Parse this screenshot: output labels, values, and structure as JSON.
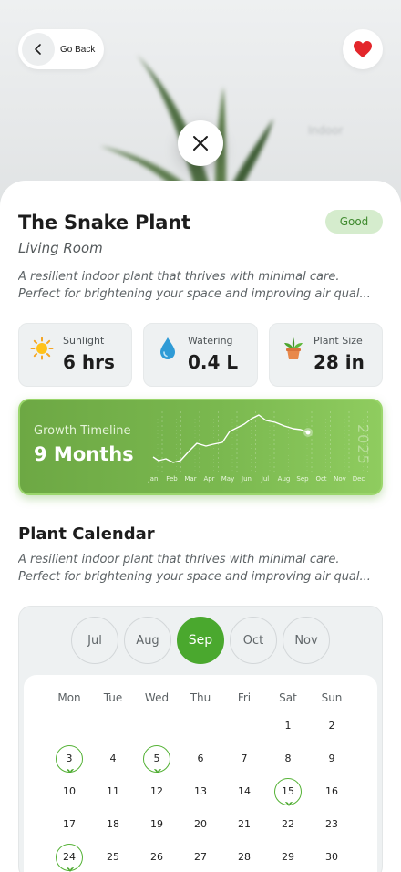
{
  "header": {
    "back_label": "Go Back",
    "hero_tag": "Indoor"
  },
  "plant": {
    "name": "The Snake Plant",
    "location": "Living Room",
    "status": "Good",
    "description": "A resilient indoor plant that thrives with minimal care. Perfect for brightening your space and improving air qual...",
    "description_line1": "A resilient indoor plant that thrives with minimal care.",
    "description_line2": "Perfect for brightening your space and improving air qual..."
  },
  "stats": [
    {
      "icon": "sun-icon",
      "label": "Sunlight",
      "value": "6 hrs"
    },
    {
      "icon": "water-drop-icon",
      "label": "Watering",
      "value": "0.4 L"
    },
    {
      "icon": "potted-plant-icon",
      "label": "Plant Size",
      "value": "28 in"
    }
  ],
  "growth": {
    "label": "Growth Timeline",
    "value": "9 Months",
    "year": "2025",
    "months": [
      "Jan",
      "Feb",
      "Mar",
      "Apr",
      "May",
      "Jun",
      "Jul",
      "Aug",
      "Sep",
      "Oct",
      "Nov",
      "Dec"
    ]
  },
  "calendar": {
    "title": "Plant Calendar",
    "description_line1": "A resilient indoor plant that thrives with minimal care.",
    "description_line2": "Perfect for brightening your space and improving air qual...",
    "months": [
      "Jul",
      "Aug",
      "Sep",
      "Oct",
      "Nov"
    ],
    "selected_month": "Sep",
    "weekdays": [
      "Mon",
      "Tue",
      "Wed",
      "Thu",
      "Fri",
      "Sat",
      "Sun"
    ],
    "weeks": [
      [
        "",
        "",
        "",
        "",
        "",
        "1",
        "2"
      ],
      [
        "3",
        "4",
        "5",
        "6",
        "7",
        "8",
        "9"
      ],
      [
        "10",
        "11",
        "12",
        "13",
        "14",
        "15",
        "16"
      ],
      [
        "17",
        "18",
        "19",
        "20",
        "21",
        "22",
        "23"
      ],
      [
        "24",
        "25",
        "26",
        "27",
        "28",
        "29",
        "30"
      ]
    ],
    "watering_days": [
      "3",
      "5",
      "15",
      "24"
    ]
  },
  "colors": {
    "accent_green": "#4aa82e",
    "favorite_red": "#e3262b",
    "badge_bg": "#d5eccd"
  }
}
